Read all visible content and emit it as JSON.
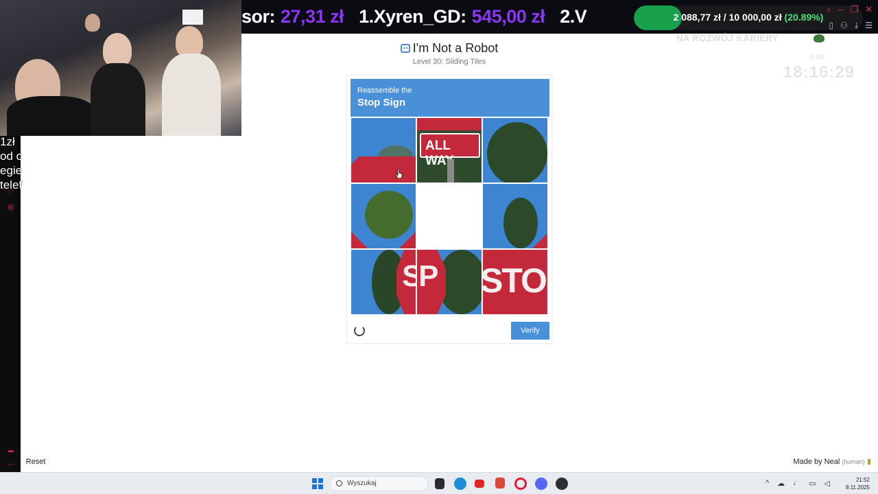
{
  "stream_overlay": {
    "ticker": [
      {
        "name": "sor:",
        "amount": "27,31 zł"
      },
      {
        "name": "1.Xyren_GD:",
        "amount": "545,00 zł"
      },
      {
        "name": "2.V",
        "amount": ""
      }
    ],
    "goal": {
      "current": "2 088,77 zł",
      "sep": " / ",
      "target": "10 000,00 zł",
      "percent": "(20.89%)",
      "fraction": 0.2089
    },
    "career_label": "NA ROZWÓJ KARIERY",
    "days_label": "3 dni",
    "clock": "18:16:29",
    "promo_lines": [
      "1zł",
      "od c",
      "egie",
      "telef"
    ]
  },
  "page": {
    "title": "I'm Not a Robot",
    "subtitle": "Level 30: Sliding Tiles"
  },
  "captcha": {
    "header_small": "Reassemble the",
    "header_big": "Stop Sign",
    "tiles": [
      "",
      "ALL WAY",
      "",
      "",
      "",
      "",
      "SP",
      "",
      "STO"
    ],
    "verify_label": "Verify"
  },
  "footer": {
    "reset_label": "Reset",
    "made_by": "Made by Neal",
    "made_by_tag": "(human)"
  },
  "taskbar": {
    "search_placeholder": "Wyszukaj",
    "time": "21:52",
    "date": "8.11.2025"
  },
  "colors": {
    "accent": "#4a90d9",
    "stop_red": "#c4283b",
    "ticker_amount": "#8b36f5",
    "goal_green": "#19a04d"
  }
}
